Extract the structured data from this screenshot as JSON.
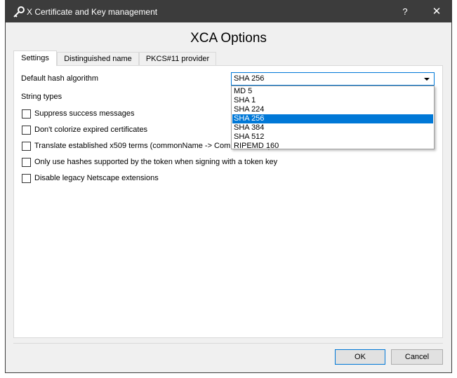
{
  "window": {
    "title": "X Certificate and Key management",
    "help_label": "?",
    "close_label": "✕"
  },
  "dialog": {
    "title": "XCA Options"
  },
  "tabs": [
    {
      "label": "Settings"
    },
    {
      "label": "Distinguished name"
    },
    {
      "label": "PKCS#11 provider"
    }
  ],
  "settings": {
    "hash_label": "Default hash algorithm",
    "hash_selected": "SHA 256",
    "hash_options": [
      "MD 5",
      "SHA 1",
      "SHA 224",
      "SHA 256",
      "SHA 384",
      "SHA 512",
      "RIPEMD 160"
    ],
    "string_types_label": "String types",
    "checkboxes": [
      {
        "label": "Suppress success messages",
        "checked": false
      },
      {
        "label": "Don't colorize expired certificates",
        "checked": false
      },
      {
        "label": "Translate established x509 terms (commonName -> Common Name)",
        "checked": false
      },
      {
        "label": "Only use hashes supported by the token when signing with a token key",
        "checked": false
      },
      {
        "label": "Disable legacy Netscape extensions",
        "checked": false
      }
    ]
  },
  "buttons": {
    "ok": "OK",
    "cancel": "Cancel"
  },
  "colors": {
    "titlebar": "#3c3c3c",
    "accent": "#0078d7"
  }
}
